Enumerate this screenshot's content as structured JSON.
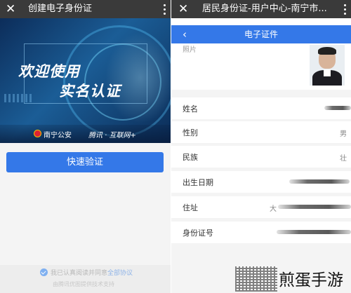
{
  "left_screen": {
    "title": "创建电子身份证",
    "banner": {
      "line1": "欢迎使用",
      "line2": "实名认证",
      "logo_police": "南宁公安",
      "logo_tencent": "腾讯 · 互联网+"
    },
    "verify_button": "快速验证",
    "agreement": {
      "text": "我已认真阅读并同意",
      "link": "全部协议",
      "subtext": "由腾讯优图提供技术支持"
    }
  },
  "right_screen": {
    "title": "居民身份证-用户中心-南宁市...",
    "nav_title": "电子证件",
    "photo_label": "照片",
    "fields": [
      {
        "label": "姓名",
        "value": ""
      },
      {
        "label": "性别",
        "value": "男"
      },
      {
        "label": "民族",
        "value": "壮"
      },
      {
        "label": "出生日期",
        "value": ""
      },
      {
        "label": "住址",
        "value": "大"
      },
      {
        "label": "身份证号",
        "value": ""
      }
    ]
  },
  "watermark": {
    "text": "煎蛋手游"
  },
  "colors": {
    "primary_blue": "#3478e8",
    "titlebar": "#3a3a3a"
  }
}
